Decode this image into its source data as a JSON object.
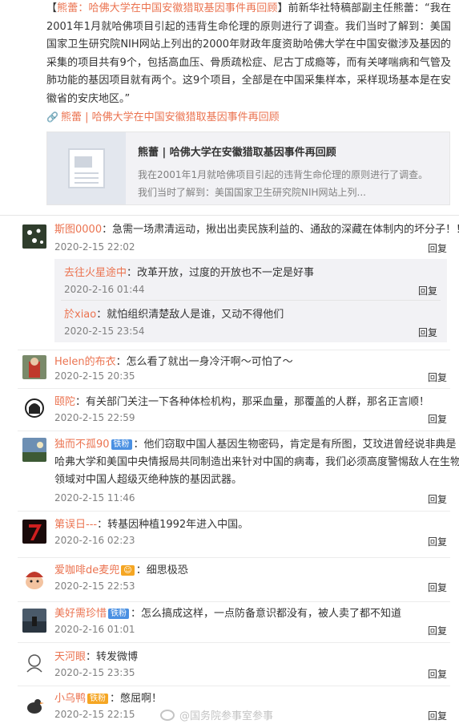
{
  "post": {
    "line1": "【",
    "line1_link": "熊蕾：哈佛大学在中国安徽猎取基因事件再回顾",
    "line1_rest": "】前新华社特稿部副主任熊蕾：“我在2001年1月就哈佛项目引起的违背生命伦理的原则进行了调查。我们当时了解到：美国国家卫生研究院NIH网站上列出的2000年财政年度资助哈佛大学在中国安徽涉及基因的采集的项目共有9个，包括高血压、骨质疏松症、尼古丁成瘾等，而有关哮喘病和气管及肺功能的基因项目就有两个。这9个项目，全部是在中国采集样本，采样现场基本是在安徽省的安庆地区。”",
    "link_icon": "paperclip-icon",
    "link_text": "熊蕾 | 哈佛大学在中国安徽猎取基因事件再回顾",
    "card": {
      "title": "熊蕾 | 哈佛大学在安徽猎取基因事件再回顾",
      "desc1": "我在2001年1月就哈佛项目引起的违背生命伦理的原则进行了调查。",
      "desc2": "我们当时了解到：美国国家卫生研究院NIH网站上列..."
    }
  },
  "reply_label": "回复",
  "comments": [
    {
      "user": "斯图0000",
      "text": "：急需一场肃清运动，揪出出卖民族利益的、通敌的深藏在体制内的坏分子！！",
      "time": "2020-2-15 22:02"
    },
    {
      "user": "去往火星途中",
      "text": "：改革开放，过度的开放也不一定是好事",
      "time": "2020-2-16 01:44"
    },
    {
      "user": "於xiao",
      "text": "：就怕组织清楚敌人是谁，又动不得他们",
      "time": "2020-2-15 23:54"
    },
    {
      "user": "Helen的布衣",
      "text": "：怎么看了就出一身冷汗啊～可怕了～",
      "time": "2020-2-15 20:35"
    },
    {
      "user": "颐陀",
      "text": "：有关部门关注一下各种体检机构，那采血量，那覆盖的人群，那名正言顺！",
      "time": "2020-2-15 22:59"
    },
    {
      "user": "独而不孤90",
      "badge": "铁粉",
      "text": "：他们窃取中国人基因生物密码，肯定是有所图，艾玟进曾经说非典是哈弗大学和美国中央情报局共同制造出来针对中国的病毒，我们必须高度警惕敌人在生物领域对中国人超级灭绝种族的基因武器。",
      "time": "2020-2-15 11:46"
    },
    {
      "user": "第误日---",
      "text": "：转基因种植1992年进入中国。",
      "time": "2020-2-16 02:23"
    },
    {
      "user": "爱咖啡de麦兜",
      "text": "：细思极恐",
      "time": "2020-2-15 22:53"
    },
    {
      "user": "美好需珍惜",
      "badge": "铁粉",
      "text": "：怎么搞成这样，一点防备意识都没有，被人卖了都不知道",
      "time": "2020-2-16 01:01"
    },
    {
      "user": "天河眼",
      "text": "：转发微博",
      "time": "2020-2-15 23:35"
    },
    {
      "user": "小乌鸭",
      "badge": "铁粉",
      "text": "：憋屈啊！",
      "time": "2020-2-15 22:15"
    }
  ],
  "watermark": "@国务院参事室参事"
}
